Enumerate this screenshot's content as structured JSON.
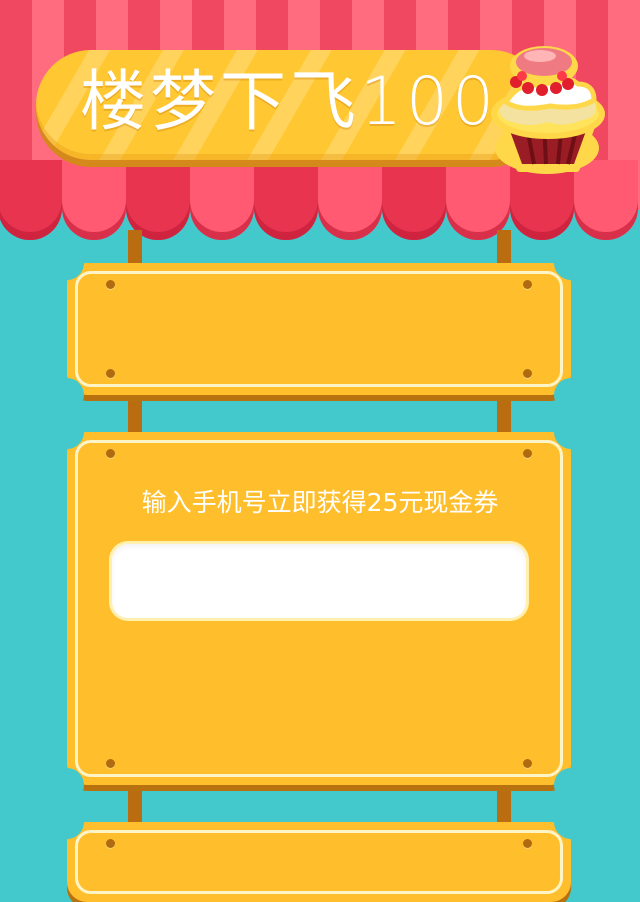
{
  "header": {
    "title": "楼梦下飞100"
  },
  "form": {
    "prompt": "输入手机号立即获得25元现金券",
    "phone_value": "",
    "phone_placeholder": ""
  },
  "icons": {
    "cupcake": "cupcake-icon"
  },
  "colors": {
    "background": "#43c8cc",
    "awning_red": "#f04860",
    "awning_pink": "#ff6b7f",
    "sign_yellow": "#ffbf2c",
    "post_brown": "#b96d10"
  }
}
